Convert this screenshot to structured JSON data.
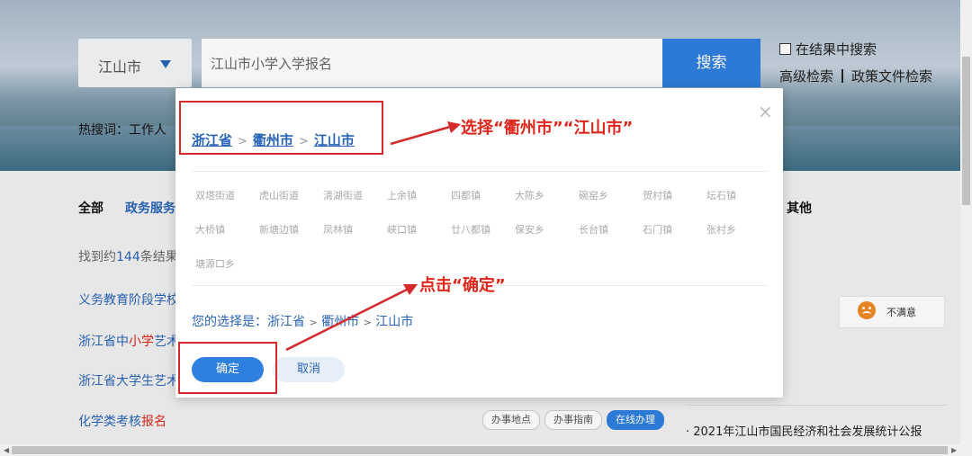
{
  "search": {
    "city_value": "江山市",
    "query": "江山市小学入学报名",
    "button": "搜索",
    "in_results_label": "在结果中搜索",
    "advanced_link": "高级检索",
    "policy_link": "政策文件检索"
  },
  "hot": {
    "label": "热搜词：工作人"
  },
  "tabs": {
    "all": "全部",
    "gov": "政务服务",
    "other": "其他"
  },
  "results": {
    "count_prefix": "找到约",
    "count": "144",
    "count_suffix": "条结果",
    "items": [
      {
        "a": "义务教育阶段学校"
      },
      {
        "a": "浙江省中",
        "r": "小学",
        "b": "艺术"
      },
      {
        "a": "浙江省大学生艺术"
      },
      {
        "a": "化学类考核",
        "r": "报名"
      }
    ],
    "actions": [
      "办事地点",
      "办事指南",
      "在线办理"
    ]
  },
  "right": {
    "unsatisfied": "不满意",
    "news": "2021年江山市国民经济和社会发展统计公报"
  },
  "modal": {
    "crumbs": [
      "浙江省",
      "衢州市",
      "江山市"
    ],
    "towns": [
      "双塔街道",
      "虎山街道",
      "清湖街道",
      "上余镇",
      "四都镇",
      "大陈乡",
      "碗窑乡",
      "贺村镇",
      "坛石镇",
      "大桥镇",
      "新塘边镇",
      "凤林镇",
      "峡口镇",
      "廿八都镇",
      "保安乡",
      "长台镇",
      "石门镇",
      "张村乡",
      "塘源口乡"
    ],
    "selection_label": "您的选择是：",
    "selection": [
      "浙江省",
      "衢州市",
      "江山市"
    ],
    "ok": "确定",
    "cancel": "取消"
  },
  "annotations": {
    "choose": "选择“衢州市”“江山市”",
    "click": "点击“确定”"
  },
  "colors": {
    "accent": "#2e7fde",
    "annotation": "#e0251b"
  }
}
